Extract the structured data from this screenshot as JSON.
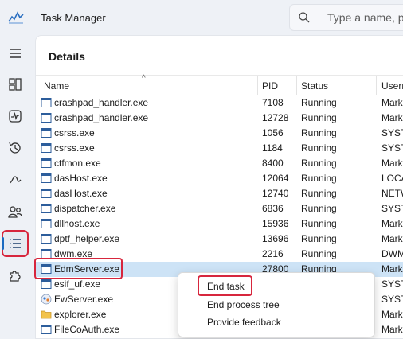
{
  "app": {
    "title": "Task Manager"
  },
  "search": {
    "placeholder": "Type a name, pu"
  },
  "page": {
    "title": "Details"
  },
  "columns": {
    "name": "Name",
    "pid": "PID",
    "status": "Status",
    "username": "Userna"
  },
  "processes": [
    {
      "name": "crashpad_handler.exe",
      "pid": "7108",
      "status": "Running",
      "user": "Mark"
    },
    {
      "name": "crashpad_handler.exe",
      "pid": "12728",
      "status": "Running",
      "user": "Mark"
    },
    {
      "name": "csrss.exe",
      "pid": "1056",
      "status": "Running",
      "user": "SYSTE"
    },
    {
      "name": "csrss.exe",
      "pid": "1184",
      "status": "Running",
      "user": "SYSTE"
    },
    {
      "name": "ctfmon.exe",
      "pid": "8400",
      "status": "Running",
      "user": "Mark"
    },
    {
      "name": "dasHost.exe",
      "pid": "12064",
      "status": "Running",
      "user": "LOCA"
    },
    {
      "name": "dasHost.exe",
      "pid": "12740",
      "status": "Running",
      "user": "NETW"
    },
    {
      "name": "dispatcher.exe",
      "pid": "6836",
      "status": "Running",
      "user": "SYSTE"
    },
    {
      "name": "dllhost.exe",
      "pid": "15936",
      "status": "Running",
      "user": "Mark"
    },
    {
      "name": "dptf_helper.exe",
      "pid": "13696",
      "status": "Running",
      "user": "Mark"
    },
    {
      "name": "dwm.exe",
      "pid": "2216",
      "status": "Running",
      "user": "DWM"
    },
    {
      "name": "EdmServer.exe",
      "pid": "27800",
      "status": "Running",
      "user": "Mark"
    },
    {
      "name": "esif_uf.exe",
      "pid": "",
      "status": "",
      "user": "SYSTE"
    },
    {
      "name": "EwServer.exe",
      "pid": "",
      "status": "",
      "user": "SYSTE"
    },
    {
      "name": "explorer.exe",
      "pid": "",
      "status": "",
      "user": "Mark"
    },
    {
      "name": "FileCoAuth.exe",
      "pid": "",
      "status": "",
      "user": "Mark"
    }
  ],
  "context_menu": {
    "end_task": "End task",
    "end_process_tree": "End process tree",
    "provide_feedback": "Provide feedback"
  },
  "colors": {
    "accent": "#1b6ac0",
    "highlight": "#d7263d",
    "selected_row": "#cde3f6"
  }
}
